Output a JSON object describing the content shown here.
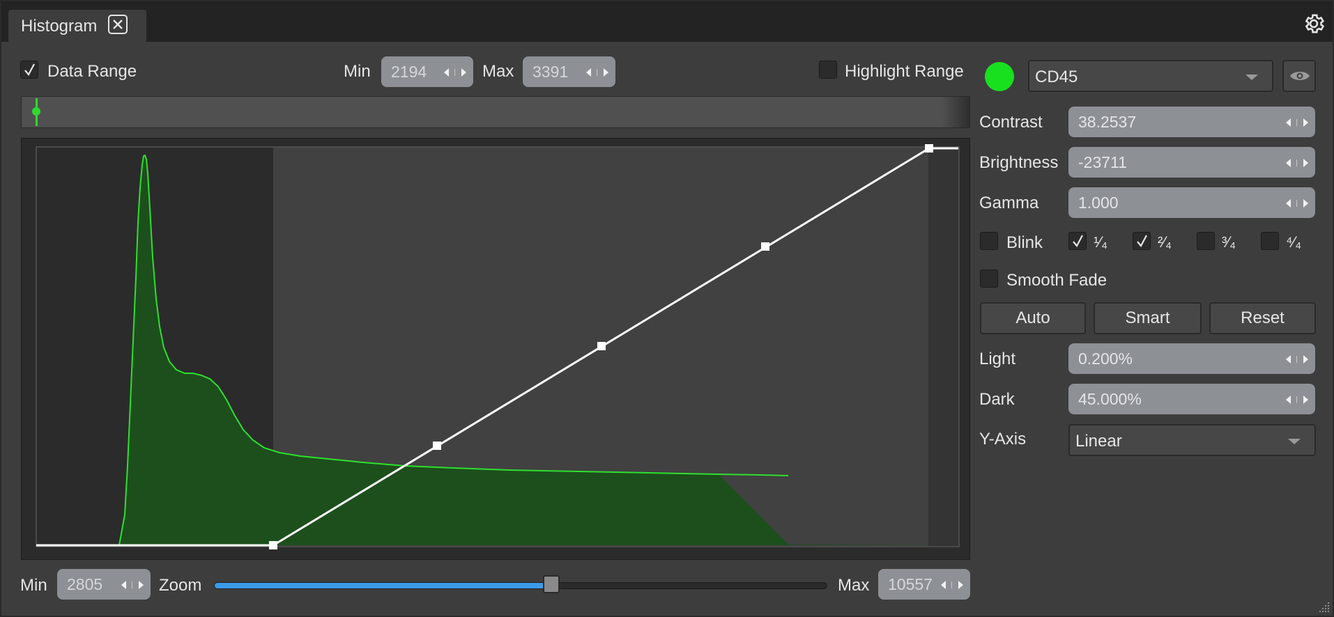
{
  "tab": {
    "title": "Histogram"
  },
  "top_bar": {
    "data_range_label": "Data Range",
    "data_range_checked": true,
    "min_label": "Min",
    "min_value": "2194",
    "max_label": "Max",
    "max_value": "3391",
    "highlight_label": "Highlight Range",
    "highlight_checked": false
  },
  "channel": {
    "color": "#19e01f",
    "name": "CD45"
  },
  "fields": {
    "contrast_label": "Contrast",
    "contrast_value": "38.2537",
    "brightness_label": "Brightness",
    "brightness_value": "-23711",
    "gamma_label": "Gamma",
    "gamma_value": "1.000",
    "light_label": "Light",
    "light_value": "0.200%",
    "dark_label": "Dark",
    "dark_value": "45.000%",
    "yaxis_label": "Y-Axis",
    "yaxis_value": "Linear"
  },
  "blink": {
    "label": "Blink",
    "checked": false,
    "quarters": [
      {
        "label": "¹⁄₄",
        "checked": true
      },
      {
        "label": "²⁄₄",
        "checked": true
      },
      {
        "label": "³⁄₄",
        "checked": false
      },
      {
        "label": "⁴⁄₄",
        "checked": false
      }
    ]
  },
  "smooth_fade": {
    "label": "Smooth Fade",
    "checked": false
  },
  "buttons": {
    "auto": "Auto",
    "smart": "Smart",
    "reset": "Reset"
  },
  "bottom_bar": {
    "min_label": "Min",
    "min_value": "2805",
    "zoom_label": "Zoom",
    "zoom_level": 0.55,
    "max_label": "Max",
    "max_value": "10557"
  },
  "icons": {
    "close": "close-icon",
    "settings": "gear-icon",
    "visibility": "eye-icon"
  }
}
